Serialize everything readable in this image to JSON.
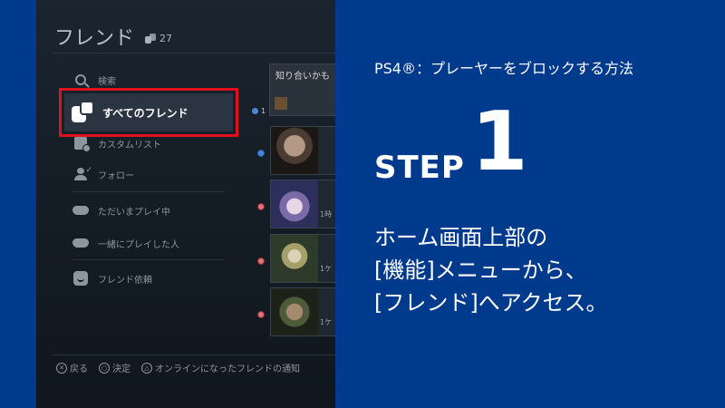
{
  "ps_screen": {
    "title": "フレンド",
    "friend_count": "27",
    "menu": {
      "search": "検索",
      "all_friends": "すべてのフレンド",
      "all_friends_count": "1",
      "custom_list": "カスタムリスト",
      "follow": "フォロー",
      "playing_now": "ただいまプレイ中",
      "played_together": "一緒にプレイした人",
      "friend_requests": "フレンド依頼"
    },
    "suggestion_title": "知り合いかも",
    "friend_tiles": [
      {
        "side": ""
      },
      {
        "side": "1時"
      },
      {
        "side": "1ケ"
      },
      {
        "side": "1ケ"
      }
    ],
    "bottom_hints": {
      "back": "戻る",
      "confirm": "決定",
      "notify": "オンラインになったフレンドの通知"
    }
  },
  "panel": {
    "subtitle": "PS4®：プレーヤーをブロックする方法",
    "step_label": "STEP",
    "step_number": "1",
    "description_lines": [
      "ホーム画面上部の",
      "[機能]メニューから、",
      "[フレンド]へアクセス。"
    ]
  },
  "colors": {
    "panel_blue": "#003a8c",
    "highlight_red": "#e0101d",
    "status_blue": "#4a86d6",
    "status_red": "#e0707a"
  }
}
